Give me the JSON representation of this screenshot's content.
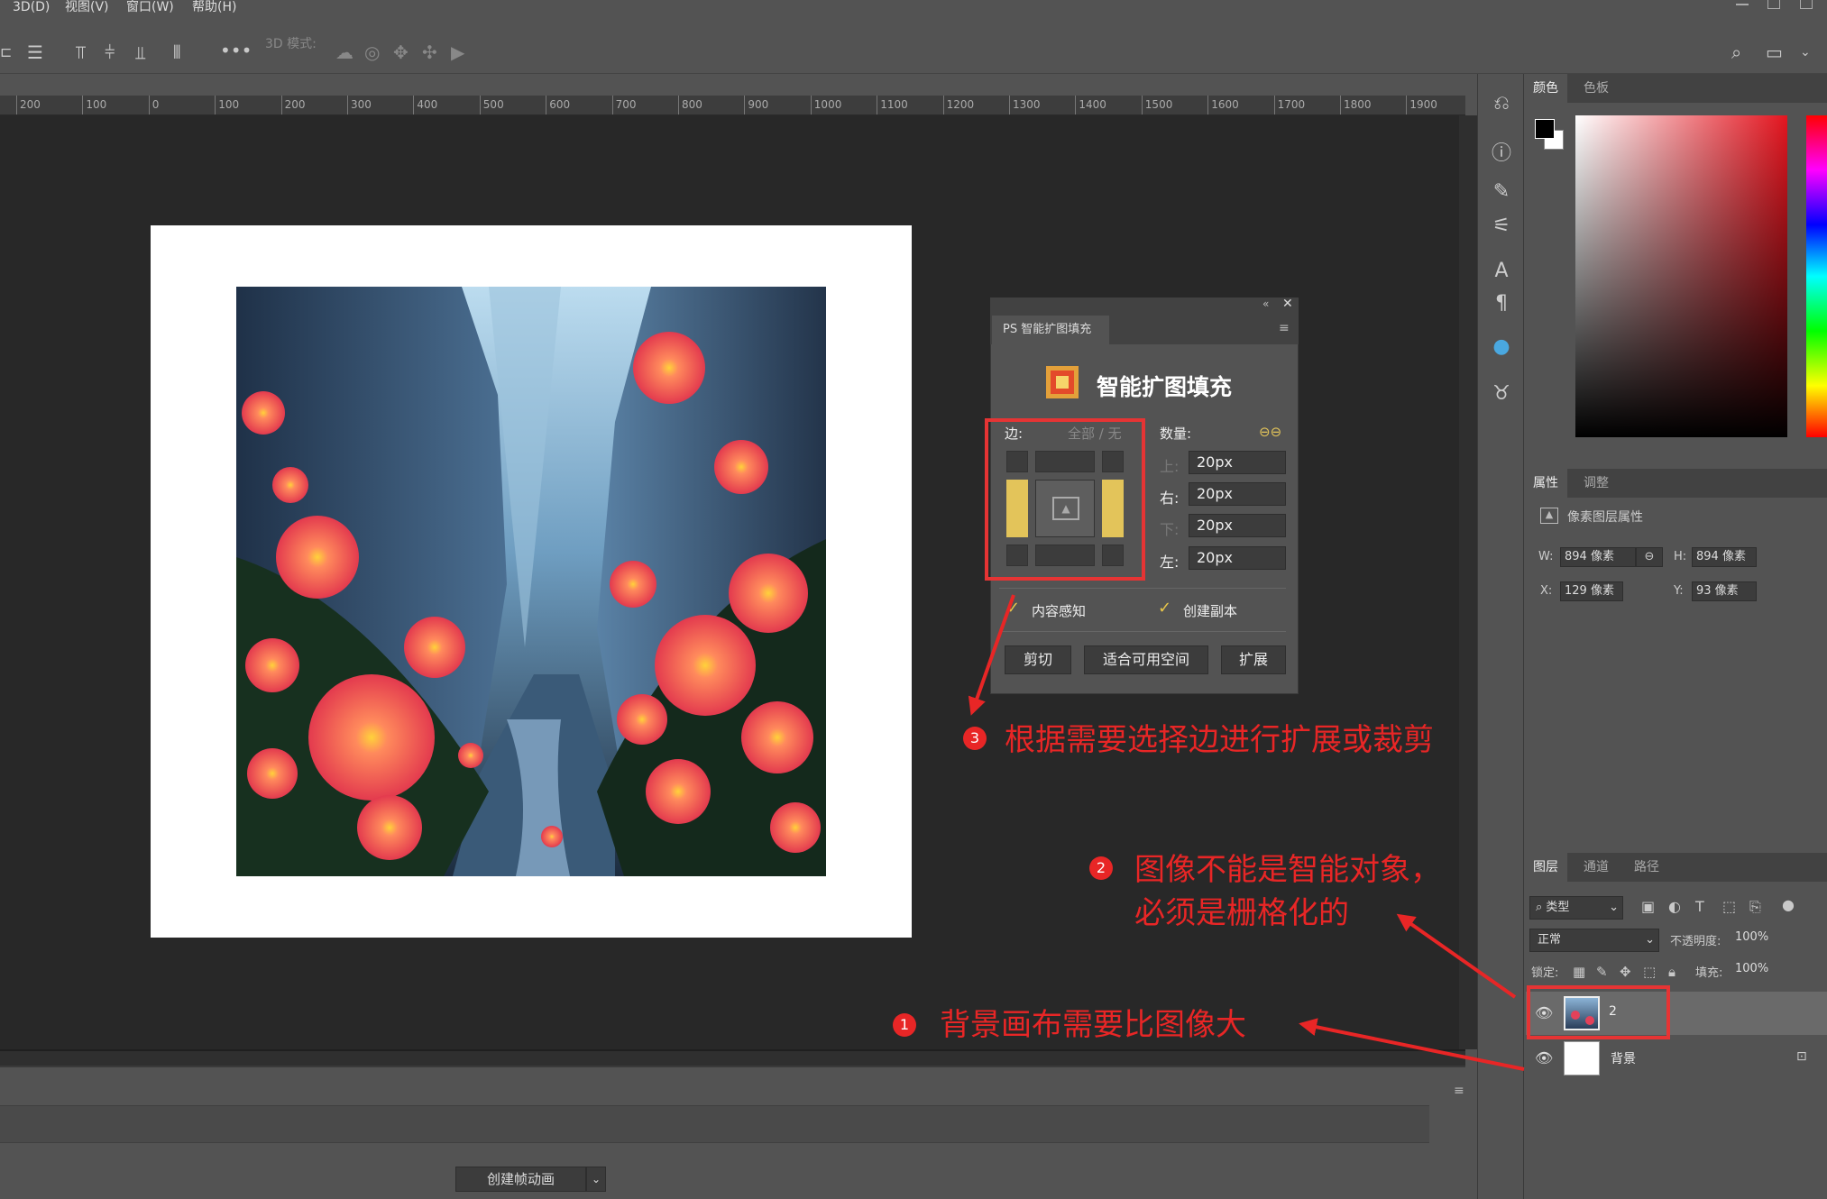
{
  "menu": {
    "items": [
      "3D(D)",
      "视图(V)",
      "窗口(W)",
      "帮助(H)"
    ]
  },
  "options_bar": {
    "mode_label": "3D 模式:"
  },
  "ruler": {
    "labels": [
      "200",
      "100",
      "0",
      "100",
      "200",
      "300",
      "400",
      "500",
      "600",
      "700",
      "800",
      "900",
      "1000",
      "1100",
      "1200",
      "1300",
      "1400",
      "1500",
      "1600",
      "1700",
      "1800",
      "1900"
    ]
  },
  "panels": {
    "color": {
      "tabs": [
        "颜色",
        "色板"
      ]
    },
    "properties": {
      "tabs": [
        "属性",
        "调整"
      ],
      "header": "像素图层属性",
      "w_label": "W:",
      "w_value": "894 像素",
      "h_label": "H:",
      "h_value": "894 像素",
      "x_label": "X:",
      "x_value": "129 像素",
      "y_label": "Y:",
      "y_value": "93 像素"
    },
    "layers": {
      "tabs": [
        "图层",
        "通道",
        "路径"
      ],
      "filter_label": "类型",
      "blend_mode": "正常",
      "opacity_label": "不透明度:",
      "opacity_value": "100%",
      "lock_label": "锁定:",
      "fill_label": "填充:",
      "fill_value": "100%",
      "items": [
        {
          "name": "2"
        },
        {
          "name": "背景"
        }
      ]
    }
  },
  "dialog": {
    "tab_label": "PS 智能扩图填充",
    "title": "智能扩图填充",
    "edge_label": "边:",
    "edge_options": "全部 / 无",
    "amount_label": "数量:",
    "top_label": "上:",
    "top_value": "20px",
    "right_label": "右:",
    "right_value": "20px",
    "bottom_label": "下:",
    "bottom_value": "20px",
    "left_label": "左:",
    "left_value": "20px",
    "content_aware": "内容感知",
    "create_copy": "创建副本",
    "btn_crop": "剪切",
    "btn_fit": "适合可用空间",
    "btn_expand": "扩展"
  },
  "annotations": {
    "a1_num": "1",
    "a1_text": "背景画布需要比图像大",
    "a2_num": "2",
    "a2_line1": "图像不能是智能对象，",
    "a2_line2": "必须是栅格化的",
    "a3_num": "3",
    "a3_text": "根据需要选择边进行扩展或裁剪"
  },
  "timeline": {
    "create_button": "创建帧动画"
  },
  "colors": {
    "accent_red": "#e82626",
    "edge_yellow": "#e3c45a",
    "canvas_dark": "#282828"
  }
}
